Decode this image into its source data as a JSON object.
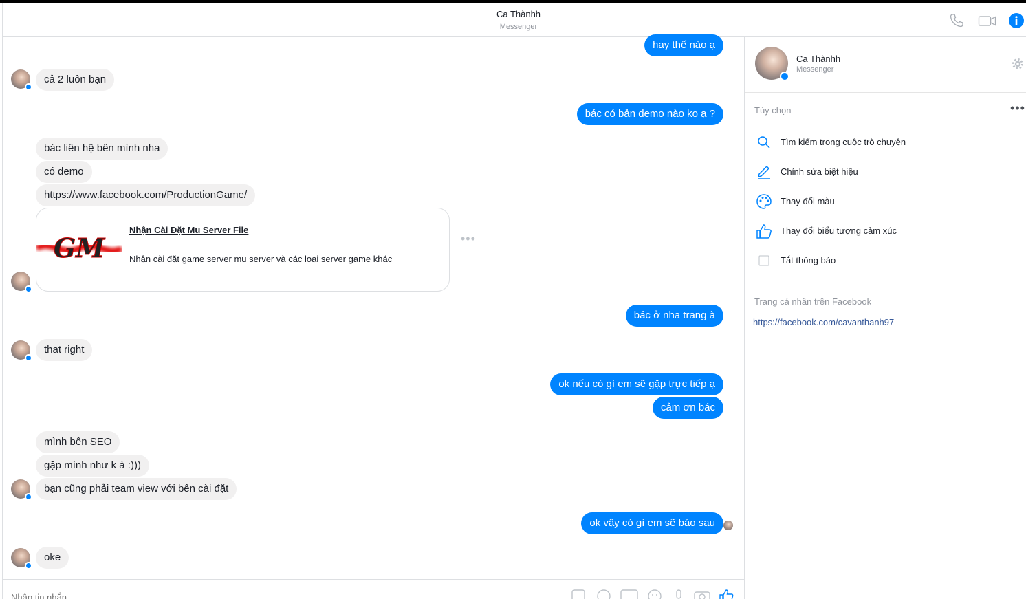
{
  "header": {
    "title": "Ca Thànhh",
    "subtitle": "Messenger",
    "icons": [
      "phone-icon",
      "video-camera-icon",
      "info-icon"
    ],
    "accent": "#0084ff"
  },
  "messages": [
    {
      "side": "out",
      "text": "hay thế nào ạ"
    },
    {
      "side": "in",
      "text": "cả 2 luôn bạn"
    },
    {
      "side": "out",
      "text": "bác có bản demo nào ko ạ ?"
    },
    {
      "side": "in",
      "text": "bác liên hệ bên mình nha"
    },
    {
      "side": "in",
      "text": "có demo"
    },
    {
      "side": "in",
      "text": "https://www.facebook.com/ProductionGame/"
    },
    {
      "side": "out",
      "text": "bác ở nha trang à"
    },
    {
      "side": "in",
      "text": "that right"
    },
    {
      "side": "out",
      "text": "ok nếu có gì em sẽ gặp trực tiếp ạ"
    },
    {
      "side": "out",
      "text": "cảm ơn bác"
    },
    {
      "side": "in",
      "text": "mình bên SEO"
    },
    {
      "side": "in",
      "text": "gặp mình như k à :)))"
    },
    {
      "side": "in",
      "text": "bạn cũng phải team view với bên cài đặt"
    },
    {
      "side": "out",
      "text": "ok vậy có gì em sẽ báo sau"
    },
    {
      "side": "in",
      "text": "oke"
    }
  ],
  "link_card": {
    "logo_text": "GM",
    "title": "Nhận Cài Đặt Mu Server File",
    "description": "Nhận cài đặt game server mu server và các loại server game khác"
  },
  "composer": {
    "placeholder": "Nhập tin nhắn...",
    "icons": [
      "sticker-icon",
      "emoji-face-icon",
      "gif-icon",
      "smiley-icon",
      "microphone-icon",
      "camera-icon",
      "thumbs-up-icon"
    ]
  },
  "sidebar": {
    "name": "Ca Thànhh",
    "subtitle": "Messenger",
    "options_header": "Tùy chọn",
    "options": [
      {
        "label": "Tìm kiếm trong cuộc trò chuyện",
        "icon": "search-icon"
      },
      {
        "label": "Chỉnh sửa biệt hiệu",
        "icon": "pencil-icon"
      },
      {
        "label": "Thay đổi màu",
        "icon": "palette-icon"
      },
      {
        "label": "Thay đổi biểu tượng cảm xúc",
        "icon": "thumbs-up-icon"
      },
      {
        "label": "Tắt thông báo",
        "icon": "checkbox-icon"
      }
    ],
    "facebook_header": "Trang cá nhân trên Facebook",
    "facebook_link": "https://facebook.com/cavanthanh97"
  }
}
